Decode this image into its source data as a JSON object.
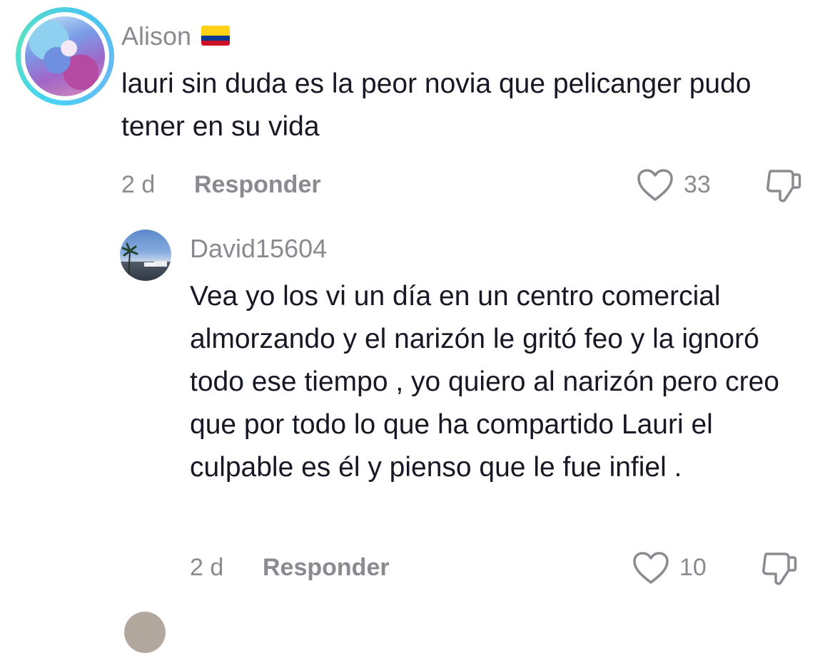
{
  "comments": [
    {
      "username": "Alison",
      "flag": "colombia-flag-icon",
      "text": "lauri sin duda es la peor novia que pelicanger pudo tener en su vida",
      "time": "2 d",
      "reply_label": "Responder",
      "likes": "33"
    },
    {
      "username": "David15604",
      "text": "Vea yo los vi un día en un centro comercial almorzando y el narizón le gritó feo y la ignoró todo ese tiempo , yo quiero al narizón pero creo que por todo lo que ha compartido Lauri el culpable es él y pienso que le fue infiel .",
      "time": "2 d",
      "reply_label": "Responder",
      "likes": "10"
    }
  ],
  "colors": {
    "text": "#161823",
    "muted": "#8a8b91",
    "ring": "#46d3f2"
  }
}
